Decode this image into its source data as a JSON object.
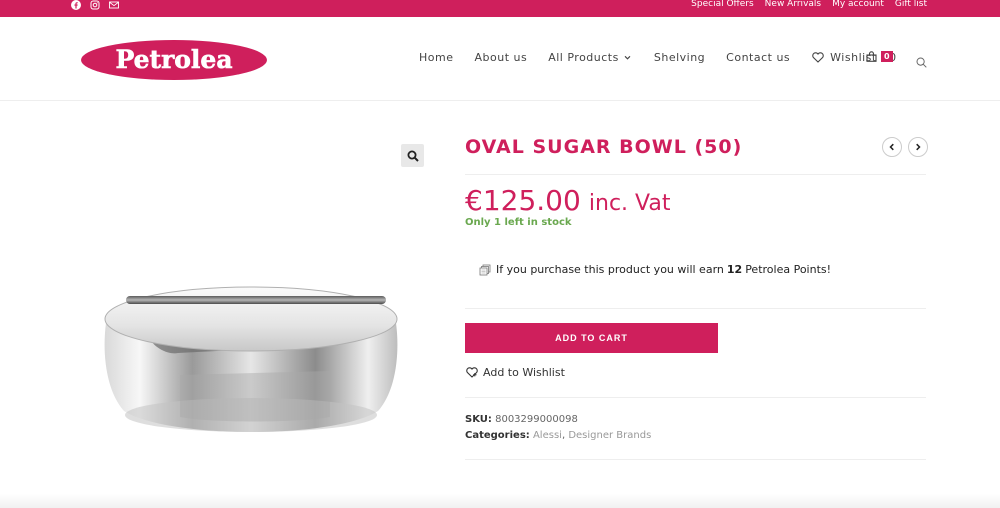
{
  "topbar": {
    "social_icons": [
      "facebook-icon",
      "instagram-icon",
      "mail-icon"
    ],
    "links": [
      "Special Offers",
      "New Arrivals",
      "My account",
      "Gift list"
    ]
  },
  "header": {
    "logo_text": "Petrolea",
    "nav": {
      "home": "Home",
      "about": "About us",
      "all_products": "All Products",
      "shelving": "Shelving",
      "contact": "Contact us",
      "wishlist": "Wishlist - 0"
    },
    "cart_count": "0"
  },
  "product": {
    "title": "OVAL SUGAR BOWL (50)",
    "price": "€125.00",
    "price_suffix": "inc. Vat",
    "stock": "Only 1 left in stock",
    "points_prefix": "If you purchase this product you will earn",
    "points_value": "12",
    "points_suffix": "Petrolea Points!",
    "add_to_cart": "ADD TO CART",
    "add_to_wishlist": "Add to Wishlist",
    "sku_label": "SKU:",
    "sku": "8003299000098",
    "categories_label": "Categories:",
    "categories": [
      "Alessi",
      "Designer Brands"
    ],
    "category_separator": ","
  },
  "colors": {
    "brand": "#cf1f5c",
    "stock": "#6aa84f"
  }
}
